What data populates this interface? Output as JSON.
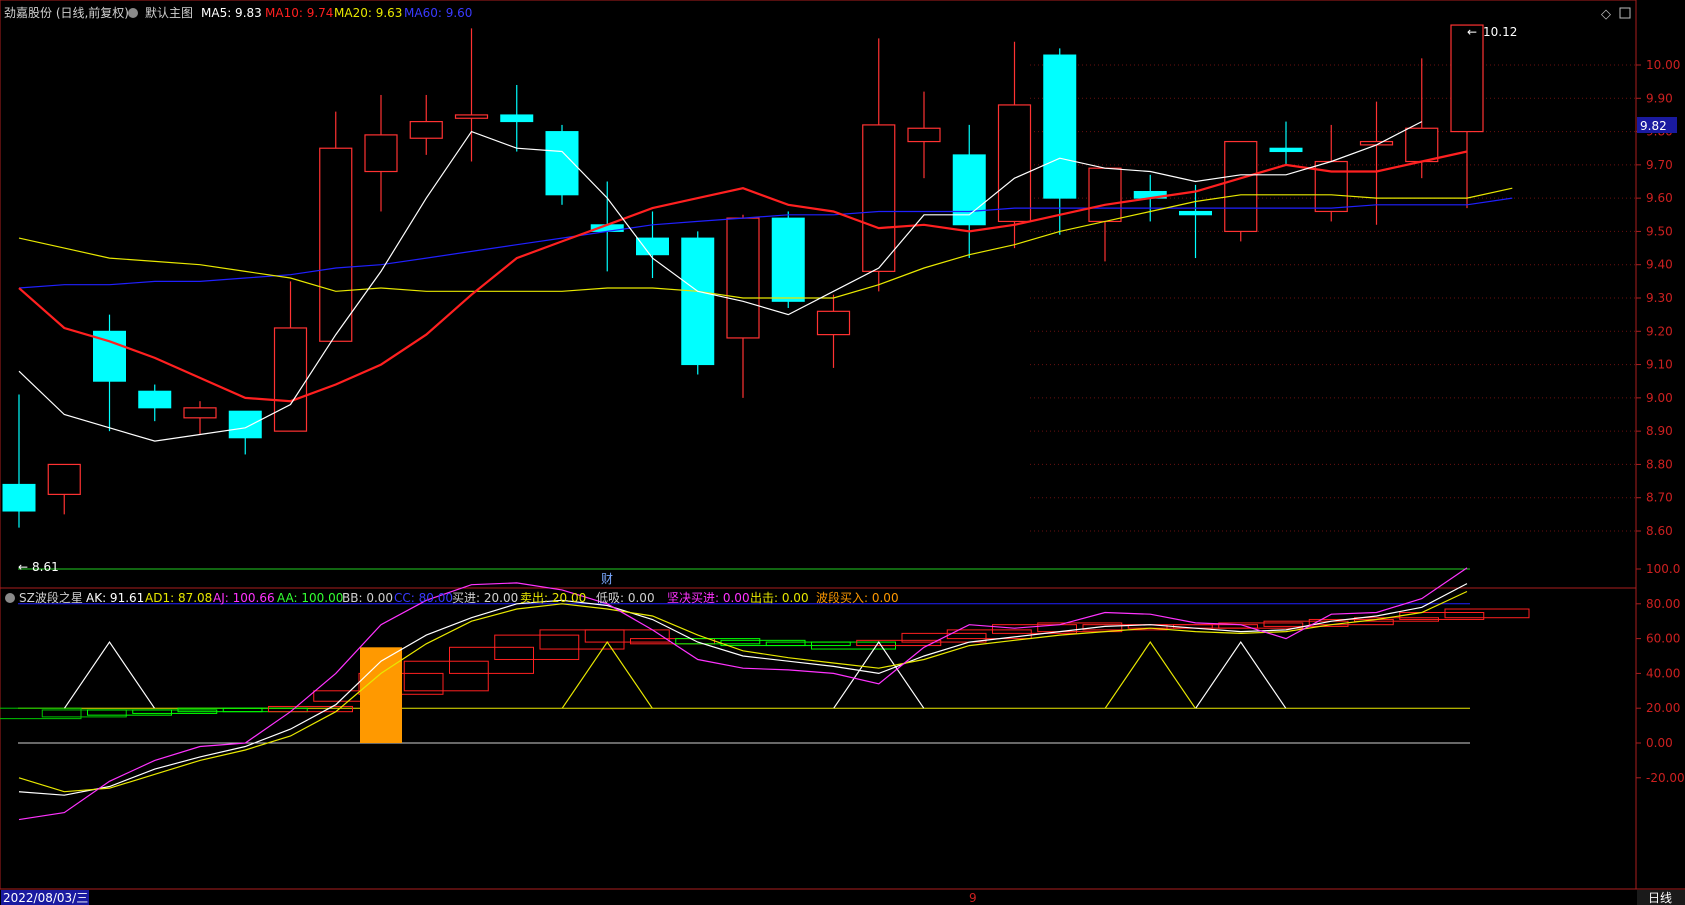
{
  "header": {
    "stock_title": "劲嘉股份 (日线,前复权)",
    "main_chart_label": "默认主图",
    "ma5_text": "MA5: 9.83",
    "ma10_text": "MA10: 9.74",
    "ma20_text": "MA20: 9.63",
    "ma60_text": "MA60: 9.60"
  },
  "indicator_header": {
    "name": "SZ波段之星",
    "ak": "AK: 91.61",
    "ad1": "AD1: 87.08",
    "aj": "AJ: 100.66",
    "aa": "AA: 100.00",
    "bb": "BB: 0.00",
    "cc": "CC: 80.00",
    "buy": "买进: 20.00",
    "sell": "卖出: 20.00",
    "dip": "低吸: 0.00",
    "firm_buy": "坚决买进: 0.00",
    "strike": "出击: 0.00",
    "wave_buy": "波段买入: 0.00"
  },
  "footer": {
    "date": "2022/08/03/三",
    "period": "日线",
    "marker": "9"
  },
  "markers": {
    "cai": "财",
    "high_label": "10.12",
    "low_label": "8.61",
    "current_price": "9.82"
  },
  "colors": {
    "up": "#ff3232",
    "down": "#00ffff",
    "ma5": "#ffffff",
    "ma10": "#ff2020",
    "ma20": "#e8e800",
    "ma60": "#2020ff",
    "axis_red": "#aa1e1e",
    "orange": "#ff9900"
  },
  "chart_data": [
    {
      "type": "candlestick",
      "title": "",
      "y_ticks": [
        "10.00",
        "9.90",
        "9.80",
        "9.70",
        "9.60",
        "9.50",
        "9.40",
        "9.30",
        "9.20",
        "9.10",
        "9.00",
        "8.90",
        "8.80",
        "8.70",
        "8.60"
      ],
      "ylim": [
        8.55,
        10.15
      ],
      "candles": [
        {
          "o": 8.74,
          "h": 9.01,
          "l": 8.61,
          "c": 8.66
        },
        {
          "o": 8.71,
          "h": 8.8,
          "l": 8.65,
          "c": 8.8
        },
        {
          "o": 9.2,
          "h": 9.25,
          "l": 8.9,
          "c": 9.05
        },
        {
          "o": 9.02,
          "h": 9.04,
          "l": 8.93,
          "c": 8.97
        },
        {
          "o": 8.94,
          "h": 8.99,
          "l": 8.89,
          "c": 8.97
        },
        {
          "o": 8.96,
          "h": 8.96,
          "l": 8.83,
          "c": 8.88
        },
        {
          "o": 8.9,
          "h": 9.35,
          "l": 8.9,
          "c": 9.21
        },
        {
          "o": 9.17,
          "h": 9.86,
          "l": 9.17,
          "c": 9.75
        },
        {
          "o": 9.68,
          "h": 9.91,
          "l": 9.56,
          "c": 9.79
        },
        {
          "o": 9.78,
          "h": 9.91,
          "l": 9.73,
          "c": 9.83
        },
        {
          "o": 9.84,
          "h": 10.11,
          "l": 9.71,
          "c": 9.85
        },
        {
          "o": 9.85,
          "h": 9.94,
          "l": 9.74,
          "c": 9.83
        },
        {
          "o": 9.8,
          "h": 9.82,
          "l": 9.58,
          "c": 9.61
        },
        {
          "o": 9.52,
          "h": 9.65,
          "l": 9.38,
          "c": 9.5
        },
        {
          "o": 9.48,
          "h": 9.56,
          "l": 9.36,
          "c": 9.43
        },
        {
          "o": 9.48,
          "h": 9.5,
          "l": 9.07,
          "c": 9.1
        },
        {
          "o": 9.18,
          "h": 9.55,
          "l": 9.0,
          "c": 9.54
        },
        {
          "o": 9.54,
          "h": 9.56,
          "l": 9.27,
          "c": 9.29
        },
        {
          "o": 9.19,
          "h": 9.31,
          "l": 9.09,
          "c": 9.26
        },
        {
          "o": 9.38,
          "h": 10.08,
          "l": 9.32,
          "c": 9.82
        },
        {
          "o": 9.77,
          "h": 9.92,
          "l": 9.66,
          "c": 9.81
        },
        {
          "o": 9.73,
          "h": 9.82,
          "l": 9.42,
          "c": 9.52
        },
        {
          "o": 9.53,
          "h": 10.07,
          "l": 9.45,
          "c": 9.88
        },
        {
          "o": 10.03,
          "h": 10.05,
          "l": 9.49,
          "c": 9.6
        },
        {
          "o": 9.53,
          "h": 9.69,
          "l": 9.41,
          "c": 9.69
        },
        {
          "o": 9.62,
          "h": 9.67,
          "l": 9.53,
          "c": 9.6
        },
        {
          "o": 9.56,
          "h": 9.64,
          "l": 9.42,
          "c": 9.55
        },
        {
          "o": 9.5,
          "h": 9.77,
          "l": 9.47,
          "c": 9.77
        },
        {
          "o": 9.75,
          "h": 9.83,
          "l": 9.7,
          "c": 9.74
        },
        {
          "o": 9.56,
          "h": 9.82,
          "l": 9.53,
          "c": 9.71
        },
        {
          "o": 9.76,
          "h": 9.89,
          "l": 9.52,
          "c": 9.77
        },
        {
          "o": 9.71,
          "h": 10.02,
          "l": 9.66,
          "c": 9.81
        },
        {
          "o": 9.8,
          "h": 10.12,
          "l": 9.57,
          "c": 10.12
        }
      ],
      "ma5": [
        9.08,
        8.95,
        8.91,
        8.87,
        8.89,
        8.91,
        8.98,
        9.19,
        9.38,
        9.6,
        9.8,
        9.75,
        9.74,
        9.6,
        9.42,
        9.32,
        9.29,
        9.25,
        9.32,
        9.39,
        9.55,
        9.55,
        9.66,
        9.72,
        9.69,
        9.68,
        9.65,
        9.67,
        9.67,
        9.71,
        9.76,
        9.83
      ],
      "ma10": [
        9.33,
        9.21,
        9.17,
        9.12,
        9.06,
        9.0,
        8.99,
        9.04,
        9.1,
        9.19,
        9.31,
        9.42,
        9.47,
        9.52,
        9.57,
        9.6,
        9.63,
        9.58,
        9.56,
        9.51,
        9.52,
        9.5,
        9.52,
        9.55,
        9.58,
        9.6,
        9.62,
        9.66,
        9.7,
        9.68,
        9.68,
        9.71,
        9.74
      ],
      "ma20": [
        9.48,
        9.45,
        9.42,
        9.41,
        9.4,
        9.38,
        9.36,
        9.32,
        9.33,
        9.32,
        9.32,
        9.32,
        9.32,
        9.33,
        9.33,
        9.32,
        9.3,
        9.3,
        9.3,
        9.34,
        9.39,
        9.43,
        9.46,
        9.5,
        9.53,
        9.56,
        9.59,
        9.61,
        9.61,
        9.61,
        9.6,
        9.6,
        9.6,
        9.63
      ],
      "ma60": [
        9.33,
        9.34,
        9.34,
        9.35,
        9.35,
        9.36,
        9.37,
        9.39,
        9.4,
        9.42,
        9.44,
        9.46,
        9.48,
        9.5,
        9.52,
        9.53,
        9.54,
        9.55,
        9.55,
        9.56,
        9.56,
        9.56,
        9.57,
        9.57,
        9.57,
        9.57,
        9.57,
        9.57,
        9.57,
        9.57,
        9.58,
        9.58,
        9.58,
        9.6
      ]
    },
    {
      "type": "line",
      "title": "SZ波段之星",
      "y_ticks": [
        "100.0",
        "80.00",
        "60.00",
        "40.00",
        "20.00",
        "0.00",
        "-20.00"
      ],
      "ylim": [
        -45,
        112
      ],
      "series": [
        {
          "name": "AK",
          "values": [
            -28,
            -30,
            -25,
            -15,
            -8,
            -2,
            8,
            22,
            47,
            62,
            72,
            80,
            82,
            79,
            71,
            58,
            50,
            47,
            44,
            40,
            50,
            58,
            61,
            64,
            67,
            68,
            66,
            64,
            65,
            70,
            73,
            78,
            91.61
          ]
        },
        {
          "name": "AD1",
          "values": [
            -20,
            -28,
            -26,
            -18,
            -10,
            -4,
            4,
            18,
            40,
            57,
            70,
            77,
            80,
            77,
            73,
            62,
            53,
            49,
            46,
            43,
            48,
            56,
            59,
            62,
            64,
            66,
            64,
            63,
            64,
            68,
            71,
            75,
            87.08
          ]
        },
        {
          "name": "AJ",
          "values": [
            -44,
            -40,
            -22,
            -10,
            -2,
            0,
            18,
            40,
            68,
            82,
            91,
            92,
            88,
            80,
            65,
            48,
            43,
            42,
            40,
            34,
            55,
            68,
            66,
            68,
            75,
            74,
            69,
            68,
            60,
            74,
            75,
            83,
            100.66
          ]
        },
        {
          "name": "AA",
          "values": [
            100,
            100,
            100,
            100,
            100,
            100,
            100,
            100,
            100,
            100,
            100,
            100,
            100,
            100,
            100,
            100,
            100,
            100,
            100,
            100,
            100,
            100,
            100,
            100,
            100,
            100,
            100,
            100,
            100,
            100,
            100,
            100,
            100
          ]
        },
        {
          "name": "CC",
          "values": [
            80,
            80,
            80,
            80,
            80,
            80,
            80,
            80,
            80,
            80,
            80,
            80,
            80,
            80,
            80,
            80,
            80,
            80,
            80,
            80,
            80,
            80,
            80,
            80,
            80,
            80,
            80,
            80,
            80,
            80,
            80,
            80,
            80
          ]
        },
        {
          "name": "BB",
          "values": [
            0,
            0,
            0,
            0,
            0,
            0,
            0,
            0,
            0,
            0,
            0,
            0,
            0,
            0,
            0,
            0,
            0,
            0,
            0,
            0,
            0,
            0,
            0,
            0,
            0,
            0,
            0,
            0,
            0,
            0,
            0,
            0,
            0
          ]
        },
        {
          "name": "买进",
          "values": [
            20,
            20,
            20,
            20,
            20,
            20,
            20,
            20,
            20,
            20,
            20,
            20,
            20,
            20,
            20,
            20,
            20,
            20,
            20,
            20,
            20,
            20,
            20,
            20,
            20,
            20,
            20,
            20,
            20,
            20,
            20,
            20,
            20
          ]
        }
      ],
      "white_triangles": [
        {
          "i": 2,
          "peak": 58
        },
        {
          "i": 19,
          "peak": 58
        },
        {
          "i": 27,
          "peak": 58
        }
      ],
      "yellow_triangles": [
        {
          "i": 13,
          "peak": 58
        },
        {
          "i": 25,
          "peak": 58
        }
      ],
      "orange_bars": [
        {
          "i": 8,
          "from": 0,
          "to": 55
        }
      ],
      "boxes": [
        {
          "i": 0,
          "lo": 14,
          "hi": 20,
          "color": "#00c800"
        },
        {
          "i": 1,
          "lo": 15,
          "hi": 19,
          "color": "#00c800"
        },
        {
          "i": 2,
          "lo": 16,
          "hi": 19,
          "color": "#00ff00"
        },
        {
          "i": 3,
          "lo": 17,
          "hi": 19,
          "color": "#00ff00"
        },
        {
          "i": 4,
          "lo": 18,
          "hi": 20,
          "color": "#00ff00"
        },
        {
          "i": 5,
          "lo": 18,
          "hi": 20,
          "color": "#00ff00"
        },
        {
          "i": 6,
          "lo": 18,
          "hi": 21,
          "color": "#ff2020"
        },
        {
          "i": 7,
          "lo": 24,
          "hi": 30,
          "color": "#ff2020"
        },
        {
          "i": 8,
          "lo": 28,
          "hi": 40,
          "color": "#ff2020"
        },
        {
          "i": 9,
          "lo": 30,
          "hi": 47,
          "color": "#ff2020"
        },
        {
          "i": 10,
          "lo": 40,
          "hi": 55,
          "color": "#ff2020"
        },
        {
          "i": 11,
          "lo": 48,
          "hi": 62,
          "color": "#ff2020"
        },
        {
          "i": 12,
          "lo": 54,
          "hi": 65,
          "color": "#ff2020"
        },
        {
          "i": 13,
          "lo": 58,
          "hi": 65,
          "color": "#ff2020"
        },
        {
          "i": 14,
          "lo": 57,
          "hi": 60,
          "color": "#ff2020"
        },
        {
          "i": 15,
          "lo": 57,
          "hi": 60,
          "color": "#00ff00"
        },
        {
          "i": 16,
          "lo": 56,
          "hi": 59,
          "color": "#00ff00"
        },
        {
          "i": 17,
          "lo": 56,
          "hi": 58,
          "color": "#00ff00"
        },
        {
          "i": 18,
          "lo": 54,
          "hi": 58,
          "color": "#00ff00"
        },
        {
          "i": 19,
          "lo": 56,
          "hi": 59,
          "color": "#ff2020"
        },
        {
          "i": 20,
          "lo": 58,
          "hi": 63,
          "color": "#ff2020"
        },
        {
          "i": 21,
          "lo": 60,
          "hi": 65,
          "color": "#ff2020"
        },
        {
          "i": 22,
          "lo": 63,
          "hi": 68,
          "color": "#ff2020"
        },
        {
          "i": 23,
          "lo": 64,
          "hi": 69,
          "color": "#ff2020"
        },
        {
          "i": 24,
          "lo": 65,
          "hi": 68,
          "color": "#ff2020"
        },
        {
          "i": 25,
          "lo": 66,
          "hi": 68,
          "color": "#ff2020"
        },
        {
          "i": 26,
          "lo": 66,
          "hi": 68,
          "color": "#ff2020"
        },
        {
          "i": 27,
          "lo": 66,
          "hi": 69,
          "color": "#ff2020"
        },
        {
          "i": 28,
          "lo": 67,
          "hi": 70,
          "color": "#ff2020"
        },
        {
          "i": 29,
          "lo": 68,
          "hi": 71,
          "color": "#ff2020"
        },
        {
          "i": 30,
          "lo": 70,
          "hi": 72,
          "color": "#ff2020"
        },
        {
          "i": 31,
          "lo": 71,
          "hi": 75,
          "color": "#ff2020"
        },
        {
          "i": 32,
          "lo": 72,
          "hi": 77,
          "color": "#ff2020"
        }
      ]
    }
  ]
}
